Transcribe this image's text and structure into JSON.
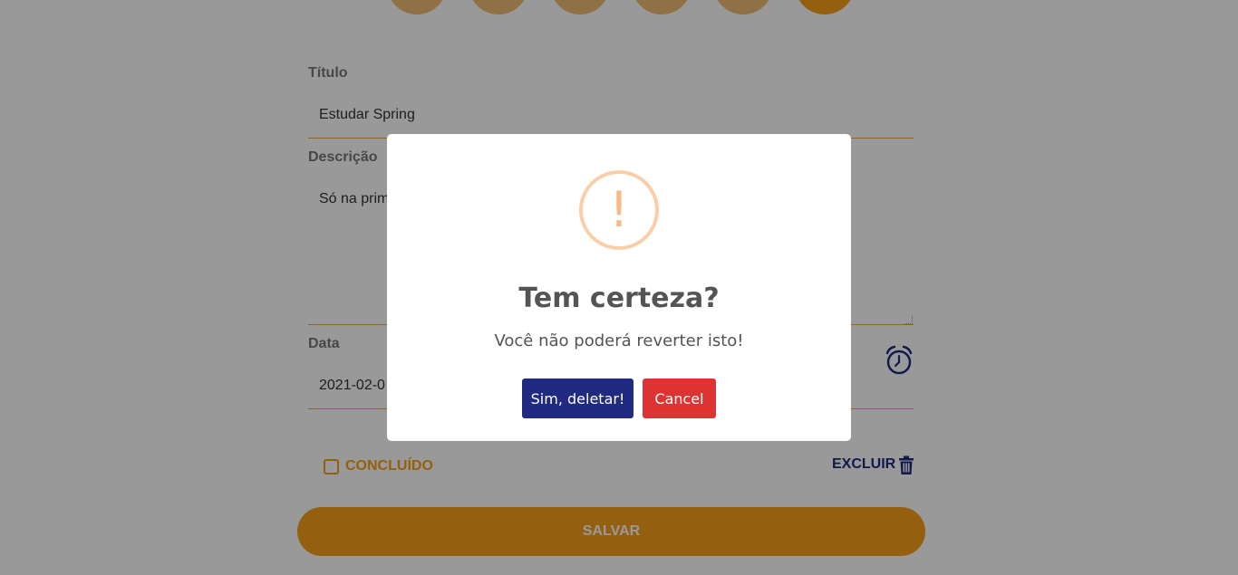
{
  "form": {
    "title_label": "Título",
    "title_value": "Estudar Spring",
    "description_label": "Descrição",
    "description_value": "Só na prim",
    "date_label": "Data",
    "date_value": "2021-02-0",
    "done_label": "CONCLUÍDO",
    "delete_label": "EXCLUIR",
    "save_label": "SALVAR"
  },
  "dialog": {
    "icon_glyph": "!",
    "title": "Tem certeza?",
    "text": "Você não poderá reverter isto!",
    "confirm_label": "Sim, deletar!",
    "cancel_label": "Cancel"
  },
  "colors": {
    "accent": "#f7a11a",
    "navy": "#1f2a80",
    "danger": "#dd3333",
    "warning": "#f8bb86"
  },
  "icons": [
    "alarm-clock-icon",
    "trash-icon",
    "warning-icon",
    "checkbox"
  ]
}
